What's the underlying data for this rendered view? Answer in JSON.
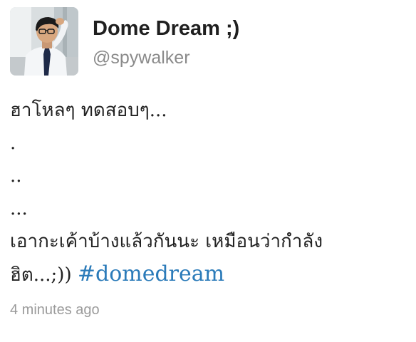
{
  "author": {
    "display_name": "Dome Dream ;)",
    "handle": "@spywalker",
    "avatar_icon": "profile-photo"
  },
  "tweet": {
    "lines": [
      "ฮาโหลๆ ทดสอบๆ...",
      ".",
      "..",
      "...",
      "เอากะเค้าบ้างแล้วกันนะ เหมือนว่ากำลัง"
    ],
    "last_line_text": "ฮิต...;)) ",
    "hashtag": "#domedream"
  },
  "timestamp": "4 minutes ago",
  "colors": {
    "hashtag": "#2b7bb9",
    "name": "#1f1f1f",
    "handle": "#8a8a8a",
    "timestamp": "#9b9b9b"
  }
}
